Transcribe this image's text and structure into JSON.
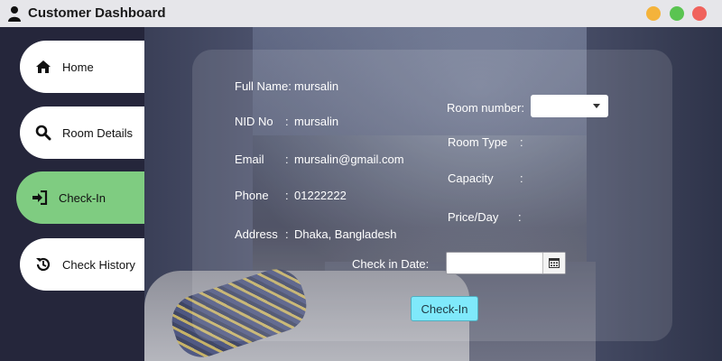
{
  "window": {
    "title": "Customer Dashboard",
    "icon": "user-icon",
    "controls": [
      "minimize",
      "maximize",
      "close"
    ],
    "colors": {
      "minimize": "#f4b33b",
      "maximize": "#5ac451",
      "close": "#f0625c"
    }
  },
  "sidebar": {
    "items": [
      {
        "label": "Home",
        "icon": "home-icon",
        "active": false
      },
      {
        "label": "Room Details",
        "icon": "search-icon",
        "active": false
      },
      {
        "label": "Check-In",
        "icon": "sign-in-icon",
        "active": true
      },
      {
        "label": "Check History",
        "icon": "history-icon",
        "active": false
      }
    ],
    "active_color": "#7fcc81"
  },
  "customer": {
    "full_name_label": "Full Name:",
    "full_name": "mursalin",
    "nid_label": "NID No",
    "nid_sep": ":",
    "nid": "mursalin",
    "email_label": "Email",
    "email_sep": ":",
    "email": "mursalin@gmail.com",
    "phone_label": "Phone",
    "phone_sep": ":",
    "phone": "01222222",
    "address_label": "Address",
    "address_sep": ":",
    "address": "Dhaka, Bangladesh"
  },
  "room": {
    "room_number_label": "Room number:",
    "room_number_value": "",
    "room_type_label": "Room Type",
    "room_type_sep": ":",
    "capacity_label": "Capacity",
    "capacity_sep": ":",
    "price_label": "Price/Day",
    "price_sep": ":"
  },
  "checkin": {
    "date_label": "Check in Date:",
    "date_value": "",
    "button_label": "Check-In",
    "button_color": "#7fe9fb"
  }
}
